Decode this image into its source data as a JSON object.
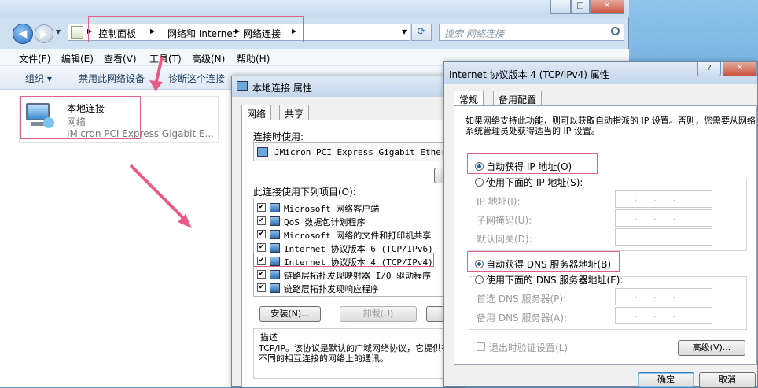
{
  "explorer": {
    "breadcrumb": [
      "控制面板",
      "网络和 Internet",
      "网络连接"
    ],
    "search_placeholder": "搜索 网络连接",
    "menu": [
      "文件(F)",
      "编辑(E)",
      "查看(V)",
      "工具(T)",
      "高级(N)",
      "帮助(H)"
    ],
    "toolbar": {
      "organize": "组织 ▾",
      "disable": "禁用此网络设备",
      "diagnose": "诊断这个连接"
    },
    "connection": {
      "name": "本地连接",
      "type": "网络",
      "device": "JMicron PCI Express Gigabit E..."
    }
  },
  "props_dialog": {
    "title": "本地连接 属性",
    "tabs": [
      "网络",
      "共享"
    ],
    "connect_using_label": "连接时使用:",
    "adapter": "JMicron PCI Express Gigabit Etherne",
    "items_label": "此连接使用下列项目(O):",
    "items": [
      {
        "label": "Microsoft 网络客户端",
        "checked": true
      },
      {
        "label": "QoS 数据包计划程序",
        "checked": true
      },
      {
        "label": "Microsoft 网络的文件和打印机共享",
        "checked": true
      },
      {
        "label": "Internet 协议版本 6 (TCP/IPv6)",
        "checked": true
      },
      {
        "label": "Internet 协议版本 4 (TCP/IPv4)",
        "checked": true
      },
      {
        "label": "链路层拓扑发现映射器 I/O 驱动程序",
        "checked": true
      },
      {
        "label": "链路层拓扑发现响应程序",
        "checked": true
      }
    ],
    "install_button": "安装(N)...",
    "uninstall_button": "卸载(U)",
    "description_label": "描述",
    "description_text": "TCP/IP。该协议是默认的广域网络协议，它提供在不同的相互连接的网络上的通讯。"
  },
  "ipv4_dialog": {
    "title": "Internet 协议版本 4 (TCP/IPv4) 属性",
    "tabs": [
      "常规",
      "备用配置"
    ],
    "intro": "如果网络支持此功能，则可以获取自动指派的 IP 设置。否则，您需要从网络系统管理员处获得适当的 IP 设置。",
    "auto_ip": "自动获得 IP 地址(O)",
    "manual_ip": "使用下面的 IP 地址(S):",
    "ip_label": "IP 地址(I):",
    "mask_label": "子网掩码(U):",
    "gateway_label": "默认网关(D):",
    "auto_dns": "自动获得 DNS 服务器地址(B)",
    "manual_dns": "使用下面的 DNS 服务器地址(E):",
    "preferred_dns": "首选 DNS 服务器(P):",
    "alternate_dns": "备用 DNS 服务器(A):",
    "ip_placeholder": ". . .",
    "validate": "退出时验证设置(L)",
    "advanced_button": "高级(V)...",
    "ok_button": "确定",
    "cancel_button": "取消"
  },
  "colors": {
    "highlight": "#e0628a",
    "accent": "#1d5fb2"
  }
}
